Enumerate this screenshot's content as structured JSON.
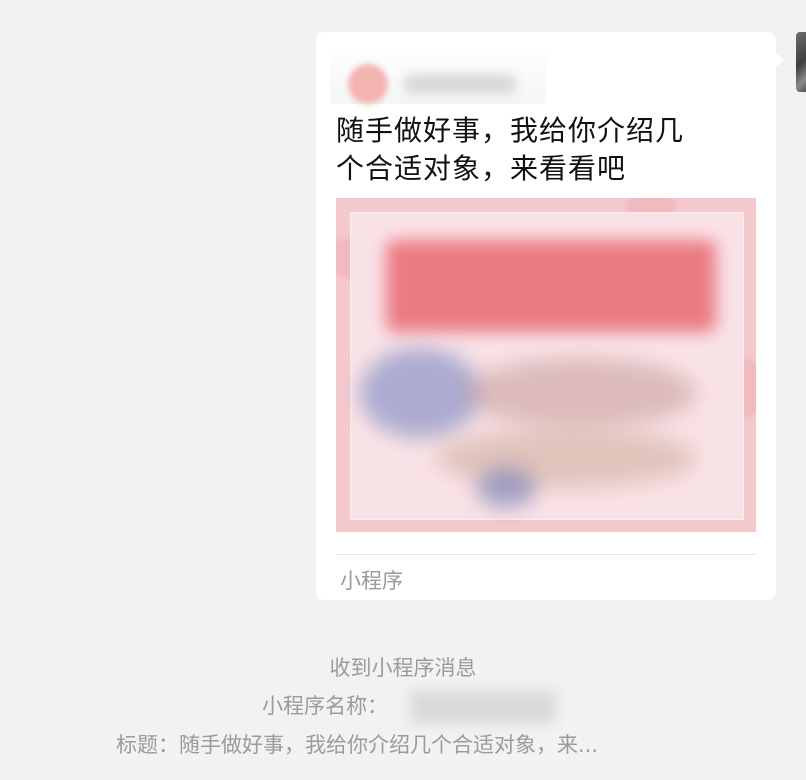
{
  "message_card": {
    "title": "随手做好事，我给你介绍几\n个合适对象，来看看吧",
    "footer_label": "小程序",
    "colors": {
      "card_bg": "#ffffff",
      "cover_pink": "#f3c9cd",
      "banner_red": "#e9707a"
    }
  },
  "system_notice": {
    "line1": "收到小程序消息",
    "line2_label": "小程序名称：",
    "line3": "标题：随手做好事，我给你介绍几个合适对象，来..."
  }
}
